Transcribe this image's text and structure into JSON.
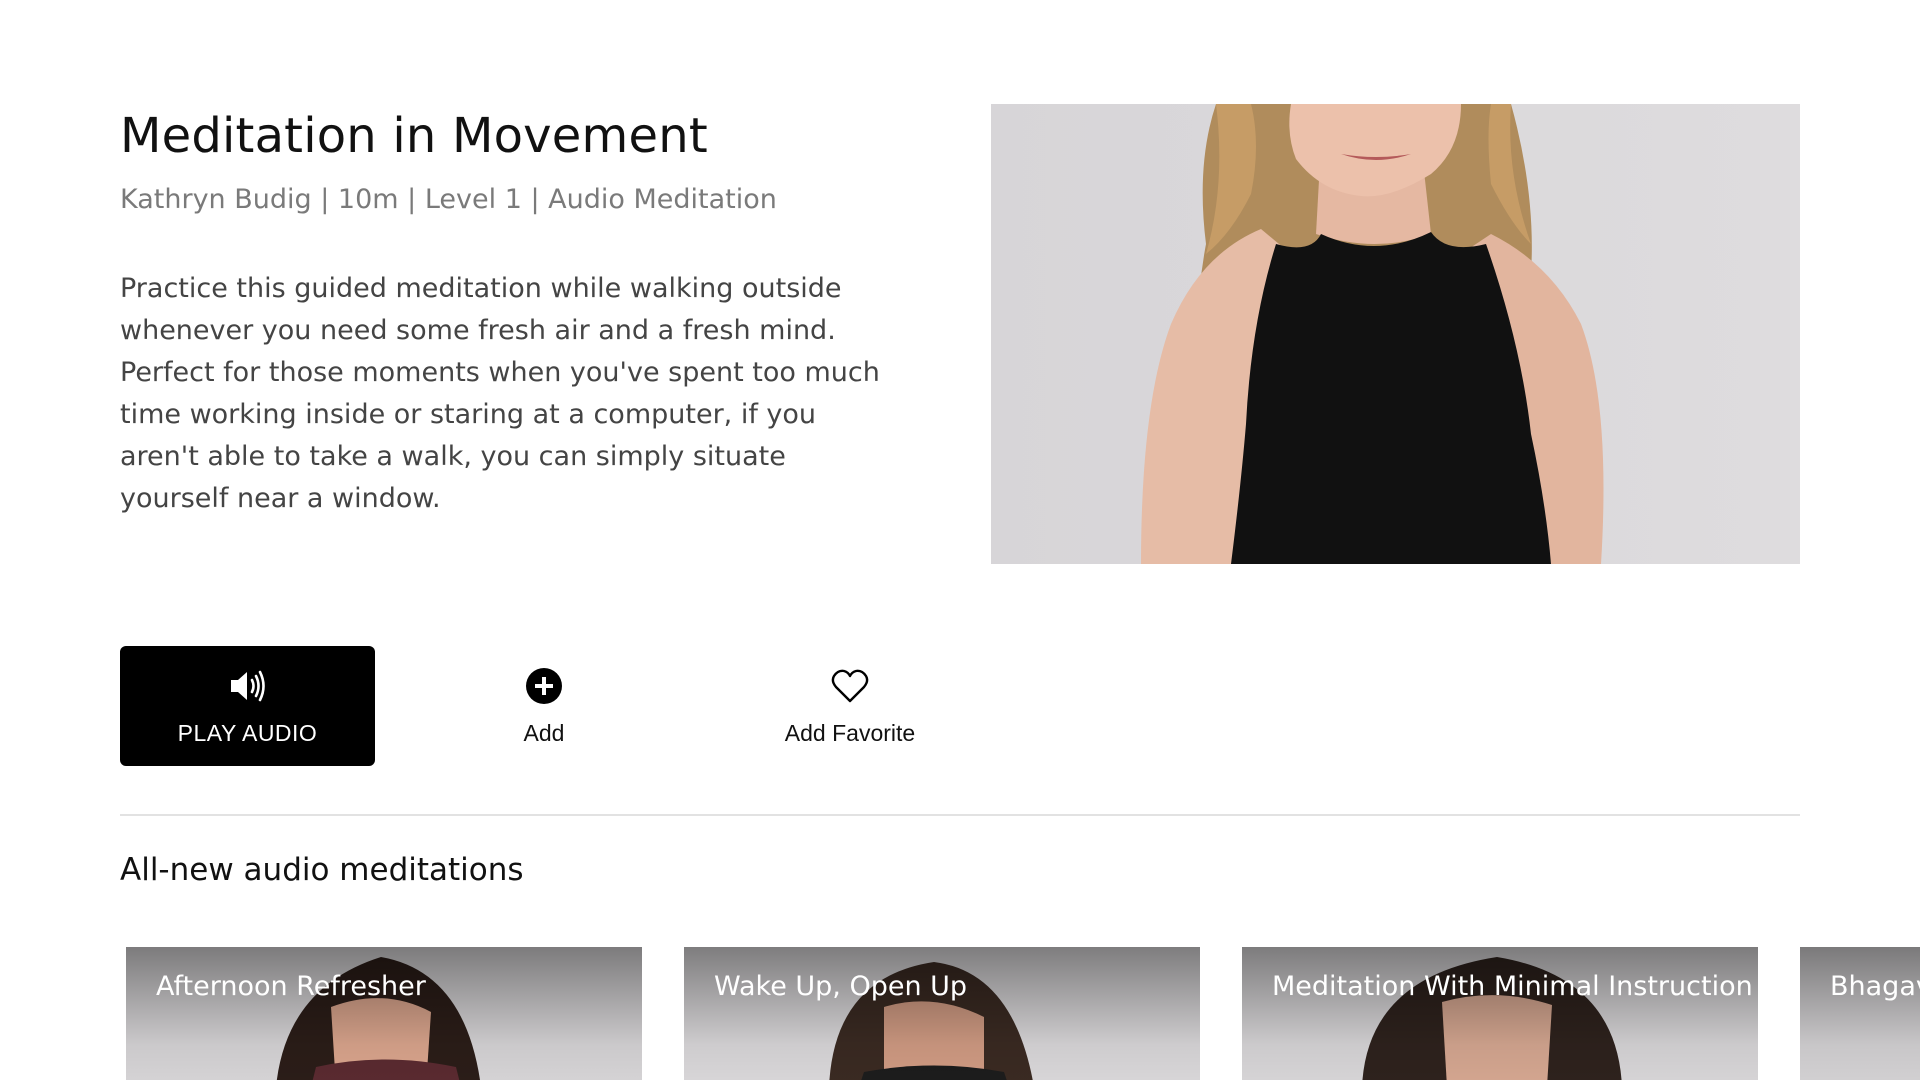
{
  "detail": {
    "title": "Meditation in Movement",
    "meta": "Kathryn Budig | 10m | Level 1 | Audio Meditation",
    "description": "Practice this guided meditation while walking outside whenever you need some fresh air and a fresh mind. Perfect for those moments when you've spent too much time working inside or staring at a computer, if you aren't able to take a walk, you can simply situate yourself near a window."
  },
  "actions": {
    "play_label": "PLAY AUDIO",
    "play_icon": "speaker-icon",
    "add_label": "Add",
    "add_icon": "plus-circle-icon",
    "favorite_label": "Add Favorite",
    "favorite_icon": "heart-outline-icon"
  },
  "related": {
    "section_title": "All-new audio meditations",
    "cards": [
      {
        "title": "Afternoon Refresher"
      },
      {
        "title": "Wake Up, Open Up"
      },
      {
        "title": "Meditation With Minimal Instruction"
      },
      {
        "title": "Bhagav"
      }
    ]
  },
  "colors": {
    "primary_button_bg": "#000000",
    "primary_button_text": "#ffffff",
    "meta_text": "#7a7a7a",
    "body_text": "#444444",
    "divider": "#e2e2e2"
  }
}
